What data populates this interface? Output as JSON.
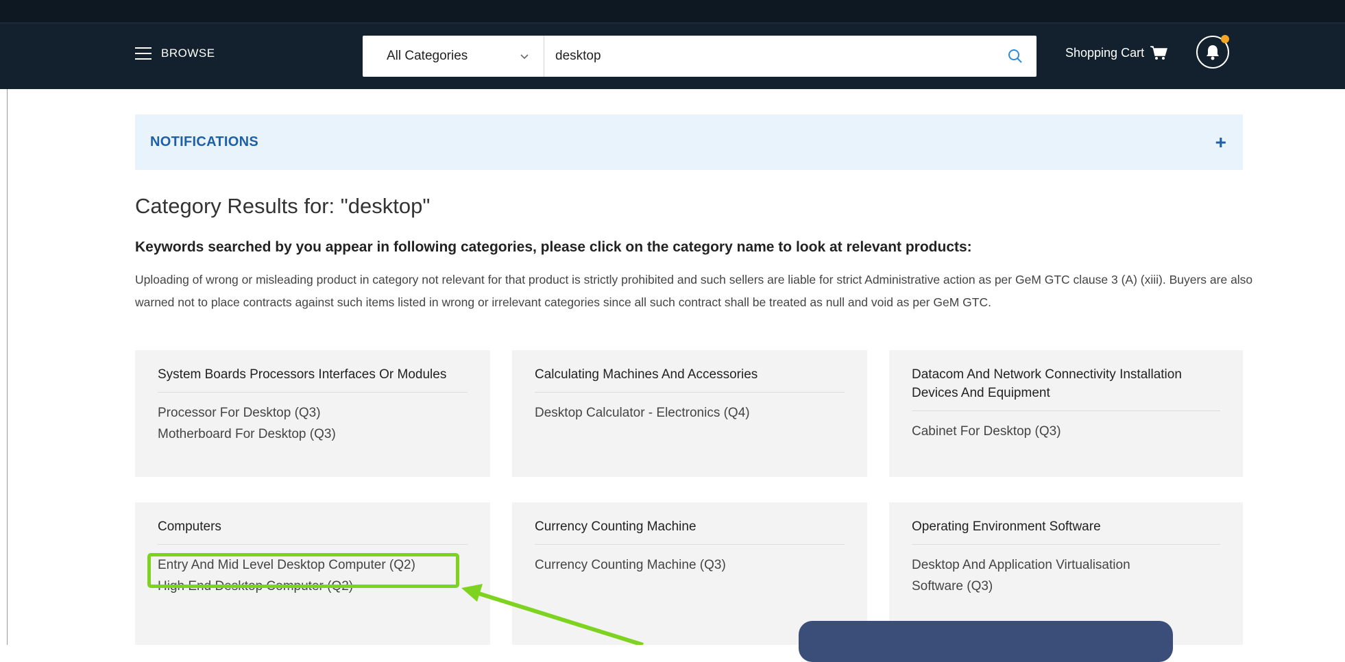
{
  "header": {
    "browse_label": "BROWSE",
    "category_select": "All Categories",
    "search_value": "desktop",
    "cart_label": "Shopping Cart"
  },
  "notifications": {
    "title": "NOTIFICATIONS",
    "toggle": "+"
  },
  "results": {
    "heading": "Category Results for: \"desktop\"",
    "subheading": "Keywords searched by you appear in following categories, please click on the category name to look at relevant products:",
    "notice": "Uploading of wrong or misleading product in category not relevant for that product is strictly prohibited and such sellers are liable for strict Administrative action as per GeM GTC clause 3 (A) (xiii). Buyers are also warned not to place contracts against such items listed in wrong or irrelevant categories since all such contract shall be treated as null and void as per GeM GTC."
  },
  "cards": [
    {
      "title": "System Boards Processors Interfaces Or Modules",
      "items": [
        "Processor For Desktop  (Q3)",
        "Motherboard For Desktop  (Q3)"
      ]
    },
    {
      "title": "Calculating Machines And Accessories",
      "items": [
        "Desktop Calculator - Electronics  (Q4)"
      ]
    },
    {
      "title": "Datacom And Network Connectivity Installation Devices And Equipment",
      "items": [
        "Cabinet For Desktop  (Q3)"
      ]
    },
    {
      "title": "Computers",
      "items": [
        "Entry And Mid Level Desktop Computer  (Q2)",
        "High End Desktop Computer  (Q2)"
      ]
    },
    {
      "title": "Currency Counting Machine",
      "items": [
        "Currency Counting Machine  (Q3)"
      ]
    },
    {
      "title": "Operating Environment Software",
      "items": [
        "Desktop And Application Virtualisation Software  (Q3)"
      ]
    }
  ],
  "colors": {
    "header_bg": "#13202e",
    "highlight": "#7ed321",
    "notif_bg": "#e8f3fb",
    "notif_text": "#1f5fa6",
    "tooltip_bg": "#3b4d79"
  },
  "icons": [
    "hamburger-icon",
    "chevron-down-icon",
    "search-icon",
    "cart-icon",
    "bell-icon"
  ]
}
